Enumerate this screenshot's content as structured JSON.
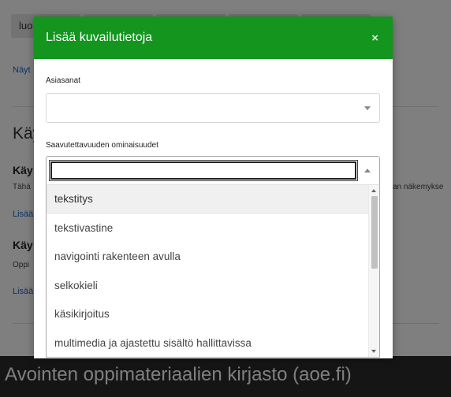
{
  "background": {
    "toolbar": [
      "luo",
      "",
      "",
      "",
      ""
    ],
    "link_top": "Näyt",
    "section_heading": "Käy",
    "subsection1": {
      "heading": "Käy",
      "text": "Tähä",
      "text_right": "an näkemykse",
      "link": "Lisää"
    },
    "subsection2": {
      "heading": "Käy",
      "text": "Oppi",
      "link": "Lisää"
    },
    "footer_title": "Avointen oppimateriaalien kirjasto (aoe.fi)"
  },
  "modal": {
    "title": "Lisää kuvailutietoja",
    "close_symbol": "×",
    "keywords": {
      "label": "Asiasanat",
      "value": ""
    },
    "accessibility": {
      "label": "Saavutettavuuden ominaisuudet",
      "search_value": "",
      "options": [
        "tekstitys",
        "tekstivastine",
        "navigointi rakenteen avulla",
        "selkokieli",
        "käsikirjoitus",
        "multimedia ja ajastettu sisältö hallittavissa"
      ],
      "highlighted_index": 0
    }
  }
}
